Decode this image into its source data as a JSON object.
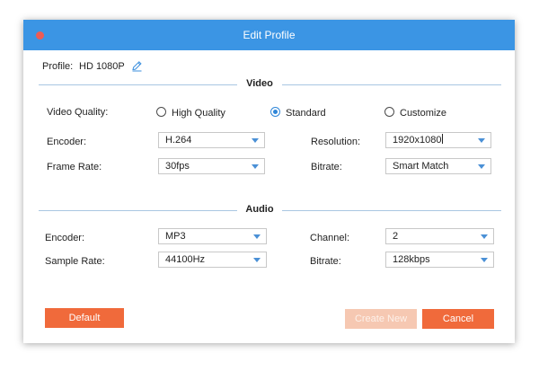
{
  "window": {
    "title": "Edit Profile"
  },
  "profile": {
    "label": "Profile:",
    "value": "HD 1080P",
    "edit_icon": "pencil-icon"
  },
  "video": {
    "section_title": "Video",
    "quality_label": "Video Quality:",
    "quality_options": [
      {
        "label": "High Quality",
        "selected": false
      },
      {
        "label": "Standard",
        "selected": true
      },
      {
        "label": "Customize",
        "selected": false
      }
    ],
    "encoder_label": "Encoder:",
    "encoder_value": "H.264",
    "resolution_label": "Resolution:",
    "resolution_value": "1920x1080",
    "frame_rate_label": "Frame Rate:",
    "frame_rate_value": "30fps",
    "bitrate_label": "Bitrate:",
    "bitrate_value": "Smart Match"
  },
  "audio": {
    "section_title": "Audio",
    "encoder_label": "Encoder:",
    "encoder_value": "MP3",
    "channel_label": "Channel:",
    "channel_value": "2",
    "sample_rate_label": "Sample Rate:",
    "sample_rate_value": "44100Hz",
    "bitrate_label": "Bitrate:",
    "bitrate_value": "128kbps"
  },
  "buttons": {
    "default_label": "Default",
    "create_new_label": "Create New",
    "cancel_label": "Cancel"
  },
  "colors": {
    "titlebar": "#3b95e4",
    "close_dot": "#ed5b55",
    "accent_orange": "#f06a3b",
    "disabled_orange": "#f6c8b2",
    "radio_selected": "#2f86d8"
  }
}
